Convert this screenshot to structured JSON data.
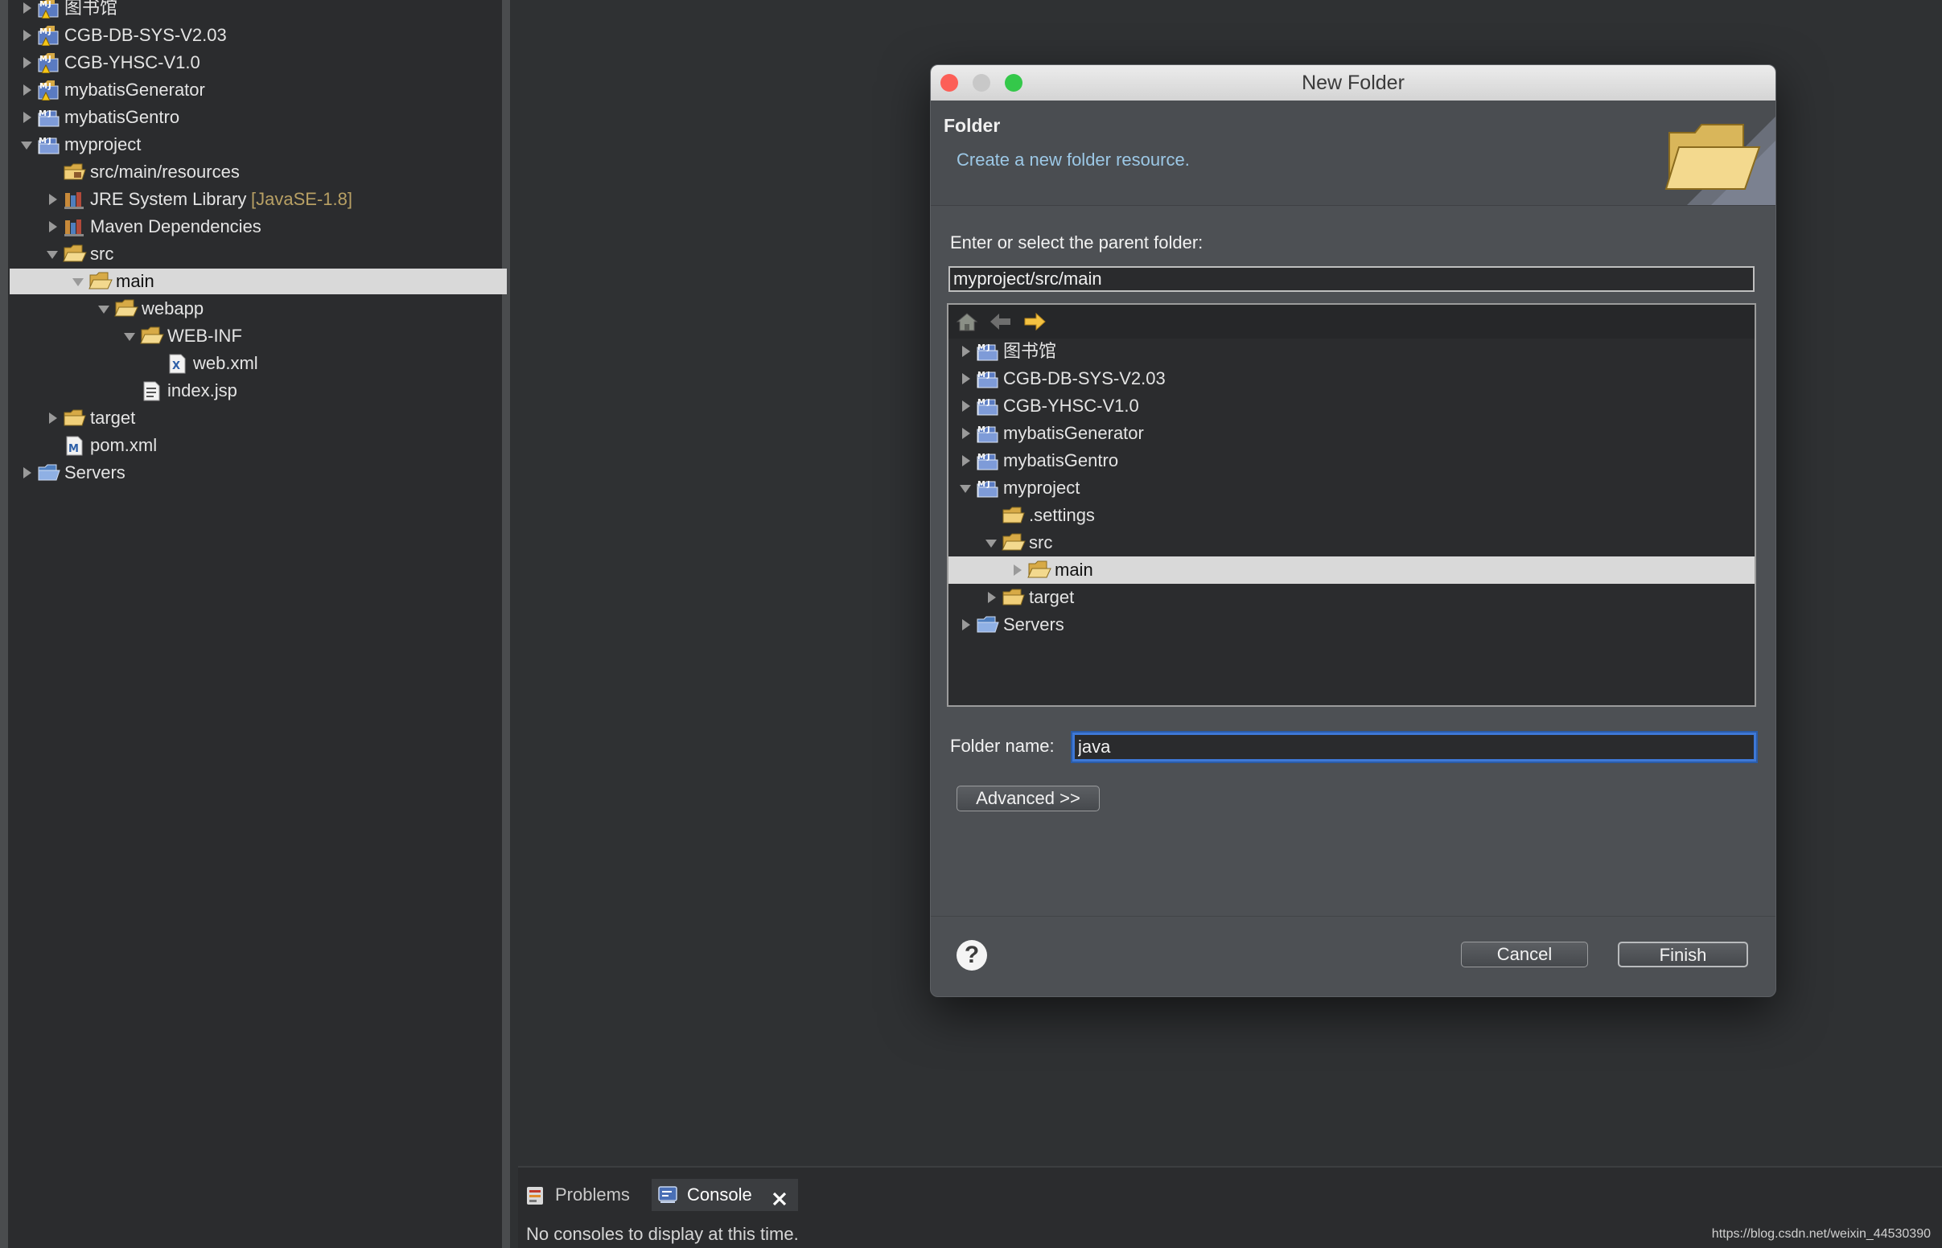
{
  "explorer": {
    "items": [
      {
        "label": "图书馆",
        "depth": 0,
        "toggle": "closed",
        "icon": "project-warning-icon",
        "selected": false
      },
      {
        "label": "CGB-DB-SYS-V2.03",
        "depth": 0,
        "toggle": "closed",
        "icon": "project-warning-icon",
        "selected": false
      },
      {
        "label": "CGB-YHSC-V1.0",
        "depth": 0,
        "toggle": "closed",
        "icon": "project-warning-icon",
        "selected": false
      },
      {
        "label": "mybatisGenerator",
        "depth": 0,
        "toggle": "closed",
        "icon": "project-warning-icon",
        "selected": false
      },
      {
        "label": "mybatisGentro",
        "depth": 0,
        "toggle": "closed",
        "icon": "maven-project-icon",
        "selected": false
      },
      {
        "label": "myproject",
        "depth": 0,
        "toggle": "open",
        "icon": "maven-project-icon",
        "selected": false
      },
      {
        "label": "src/main/resources",
        "depth": 1,
        "toggle": "none",
        "icon": "source-folder-icon",
        "selected": false
      },
      {
        "label": "JRE System Library",
        "suffix": "[JavaSE-1.8]",
        "depth": 1,
        "toggle": "closed",
        "icon": "library-icon",
        "selected": false
      },
      {
        "label": "Maven Dependencies",
        "depth": 1,
        "toggle": "closed",
        "icon": "library-icon",
        "selected": false
      },
      {
        "label": "src",
        "depth": 1,
        "toggle": "open",
        "icon": "open-folder-icon",
        "selected": false
      },
      {
        "label": "main",
        "depth": 2,
        "toggle": "open",
        "icon": "open-folder-icon",
        "selected": true
      },
      {
        "label": "webapp",
        "depth": 3,
        "toggle": "open",
        "icon": "open-folder-icon",
        "selected": false
      },
      {
        "label": "WEB-INF",
        "depth": 4,
        "toggle": "open",
        "icon": "open-folder-icon",
        "selected": false
      },
      {
        "label": "web.xml",
        "depth": 5,
        "toggle": "none",
        "icon": "xml-file-icon",
        "selected": false
      },
      {
        "label": "index.jsp",
        "depth": 4,
        "toggle": "none",
        "icon": "jsp-file-icon",
        "selected": false
      },
      {
        "label": "target",
        "depth": 1,
        "toggle": "closed",
        "icon": "folder-icon",
        "selected": false
      },
      {
        "label": "pom.xml",
        "depth": 1,
        "toggle": "none",
        "icon": "pom-file-icon",
        "selected": false
      },
      {
        "label": "Servers",
        "depth": 0,
        "toggle": "closed",
        "icon": "servers-folder-icon",
        "selected": false
      }
    ]
  },
  "dialog": {
    "title": "New Folder",
    "header_title": "Folder",
    "header_desc": "Create a new folder resource.",
    "parent_label": "Enter or select the parent folder:",
    "parent_value": "myproject/src/main",
    "tree": [
      {
        "label": "图书馆",
        "depth": 0,
        "toggle": "closed",
        "icon": "project-icon",
        "selected": false
      },
      {
        "label": "CGB-DB-SYS-V2.03",
        "depth": 0,
        "toggle": "closed",
        "icon": "project-icon",
        "selected": false
      },
      {
        "label": "CGB-YHSC-V1.0",
        "depth": 0,
        "toggle": "closed",
        "icon": "project-icon",
        "selected": false
      },
      {
        "label": "mybatisGenerator",
        "depth": 0,
        "toggle": "closed",
        "icon": "project-icon",
        "selected": false
      },
      {
        "label": "mybatisGentro",
        "depth": 0,
        "toggle": "closed",
        "icon": "project-icon",
        "selected": false
      },
      {
        "label": "myproject",
        "depth": 0,
        "toggle": "open",
        "icon": "project-icon",
        "selected": false
      },
      {
        "label": ".settings",
        "depth": 1,
        "toggle": "none",
        "icon": "folder-icon",
        "selected": false
      },
      {
        "label": "src",
        "depth": 1,
        "toggle": "open",
        "icon": "open-folder-icon",
        "selected": false
      },
      {
        "label": "main",
        "depth": 2,
        "toggle": "closed",
        "icon": "open-folder-icon",
        "selected": true
      },
      {
        "label": "target",
        "depth": 1,
        "toggle": "closed",
        "icon": "folder-icon",
        "selected": false
      },
      {
        "label": "Servers",
        "depth": 0,
        "toggle": "closed",
        "icon": "servers-folder-icon",
        "selected": false
      }
    ],
    "folder_name_label": "Folder name:",
    "folder_name_value": "java",
    "advanced_label": "Advanced >>",
    "cancel_label": "Cancel",
    "finish_label": "Finish",
    "help_glyph": "?"
  },
  "bottom": {
    "problems_tab": "Problems",
    "console_tab": "Console",
    "console_message": "No consoles to display at this time.",
    "watermark": "https://blog.csdn.net/weixin_44530390"
  },
  "colors": {
    "close": "#fc5f57",
    "minimize": "#c8c8c8",
    "zoom": "#34c84a",
    "selection": "#d9d9d9",
    "focus_ring": "#3e78d6",
    "folder": "#e7be5e"
  }
}
